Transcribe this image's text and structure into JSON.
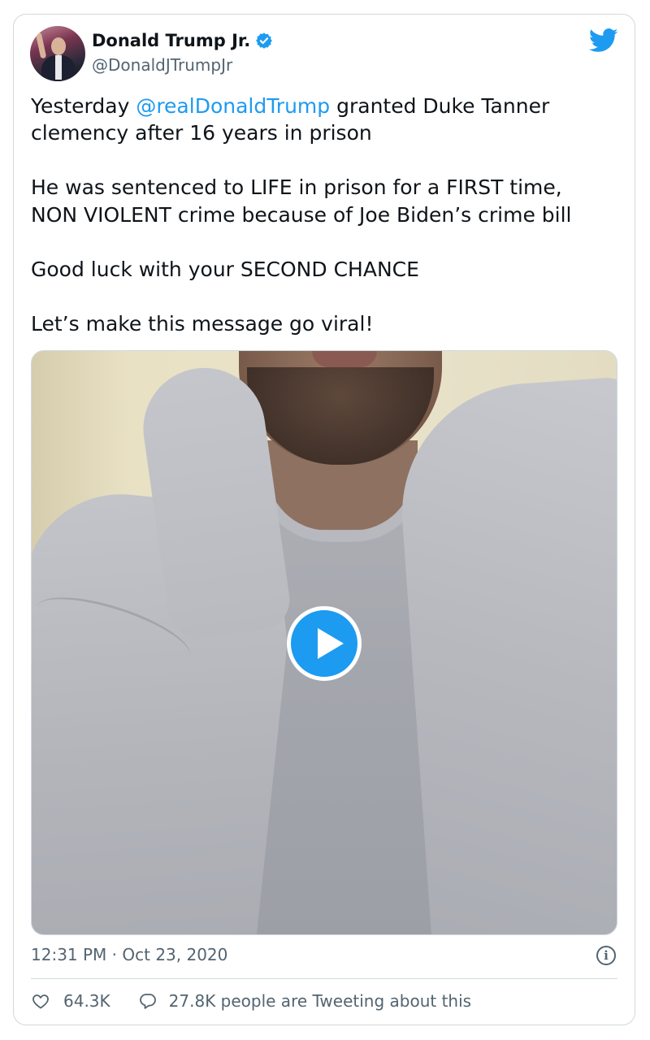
{
  "tweet": {
    "display_name": "Donald Trump Jr.",
    "handle": "@DonaldJTrumpJr",
    "text_lines": [
      {
        "before": "Yesterday ",
        "mention": "@realDonaldTrump",
        "after": " granted Duke Tanner"
      },
      {
        "text": "clemency after 16 years in prison"
      },
      {
        "text": "He was sentenced to LIFE in prison for a FIRST time,"
      },
      {
        "text": "NON VIOLENT crime because of Joe Biden’s crime bill"
      },
      {
        "text": "Good luck with your SECOND CHANCE"
      },
      {
        "text": "Let’s make this message go viral!"
      }
    ],
    "timestamp": "12:31 PM · Oct 23, 2020",
    "likes": "64.3K",
    "retweet_text": "27.8K people are Tweeting about this"
  },
  "icons": {
    "verified": "verified-badge-icon",
    "brand": "twitter-bird-icon",
    "play": "play-icon",
    "info": "info-icon",
    "like": "heart-icon",
    "reply": "speech-bubble-icon"
  },
  "colors": {
    "accent": "#1d9bf0",
    "text": "#0f1419",
    "muted": "#536471",
    "border": "#cfd9de"
  }
}
